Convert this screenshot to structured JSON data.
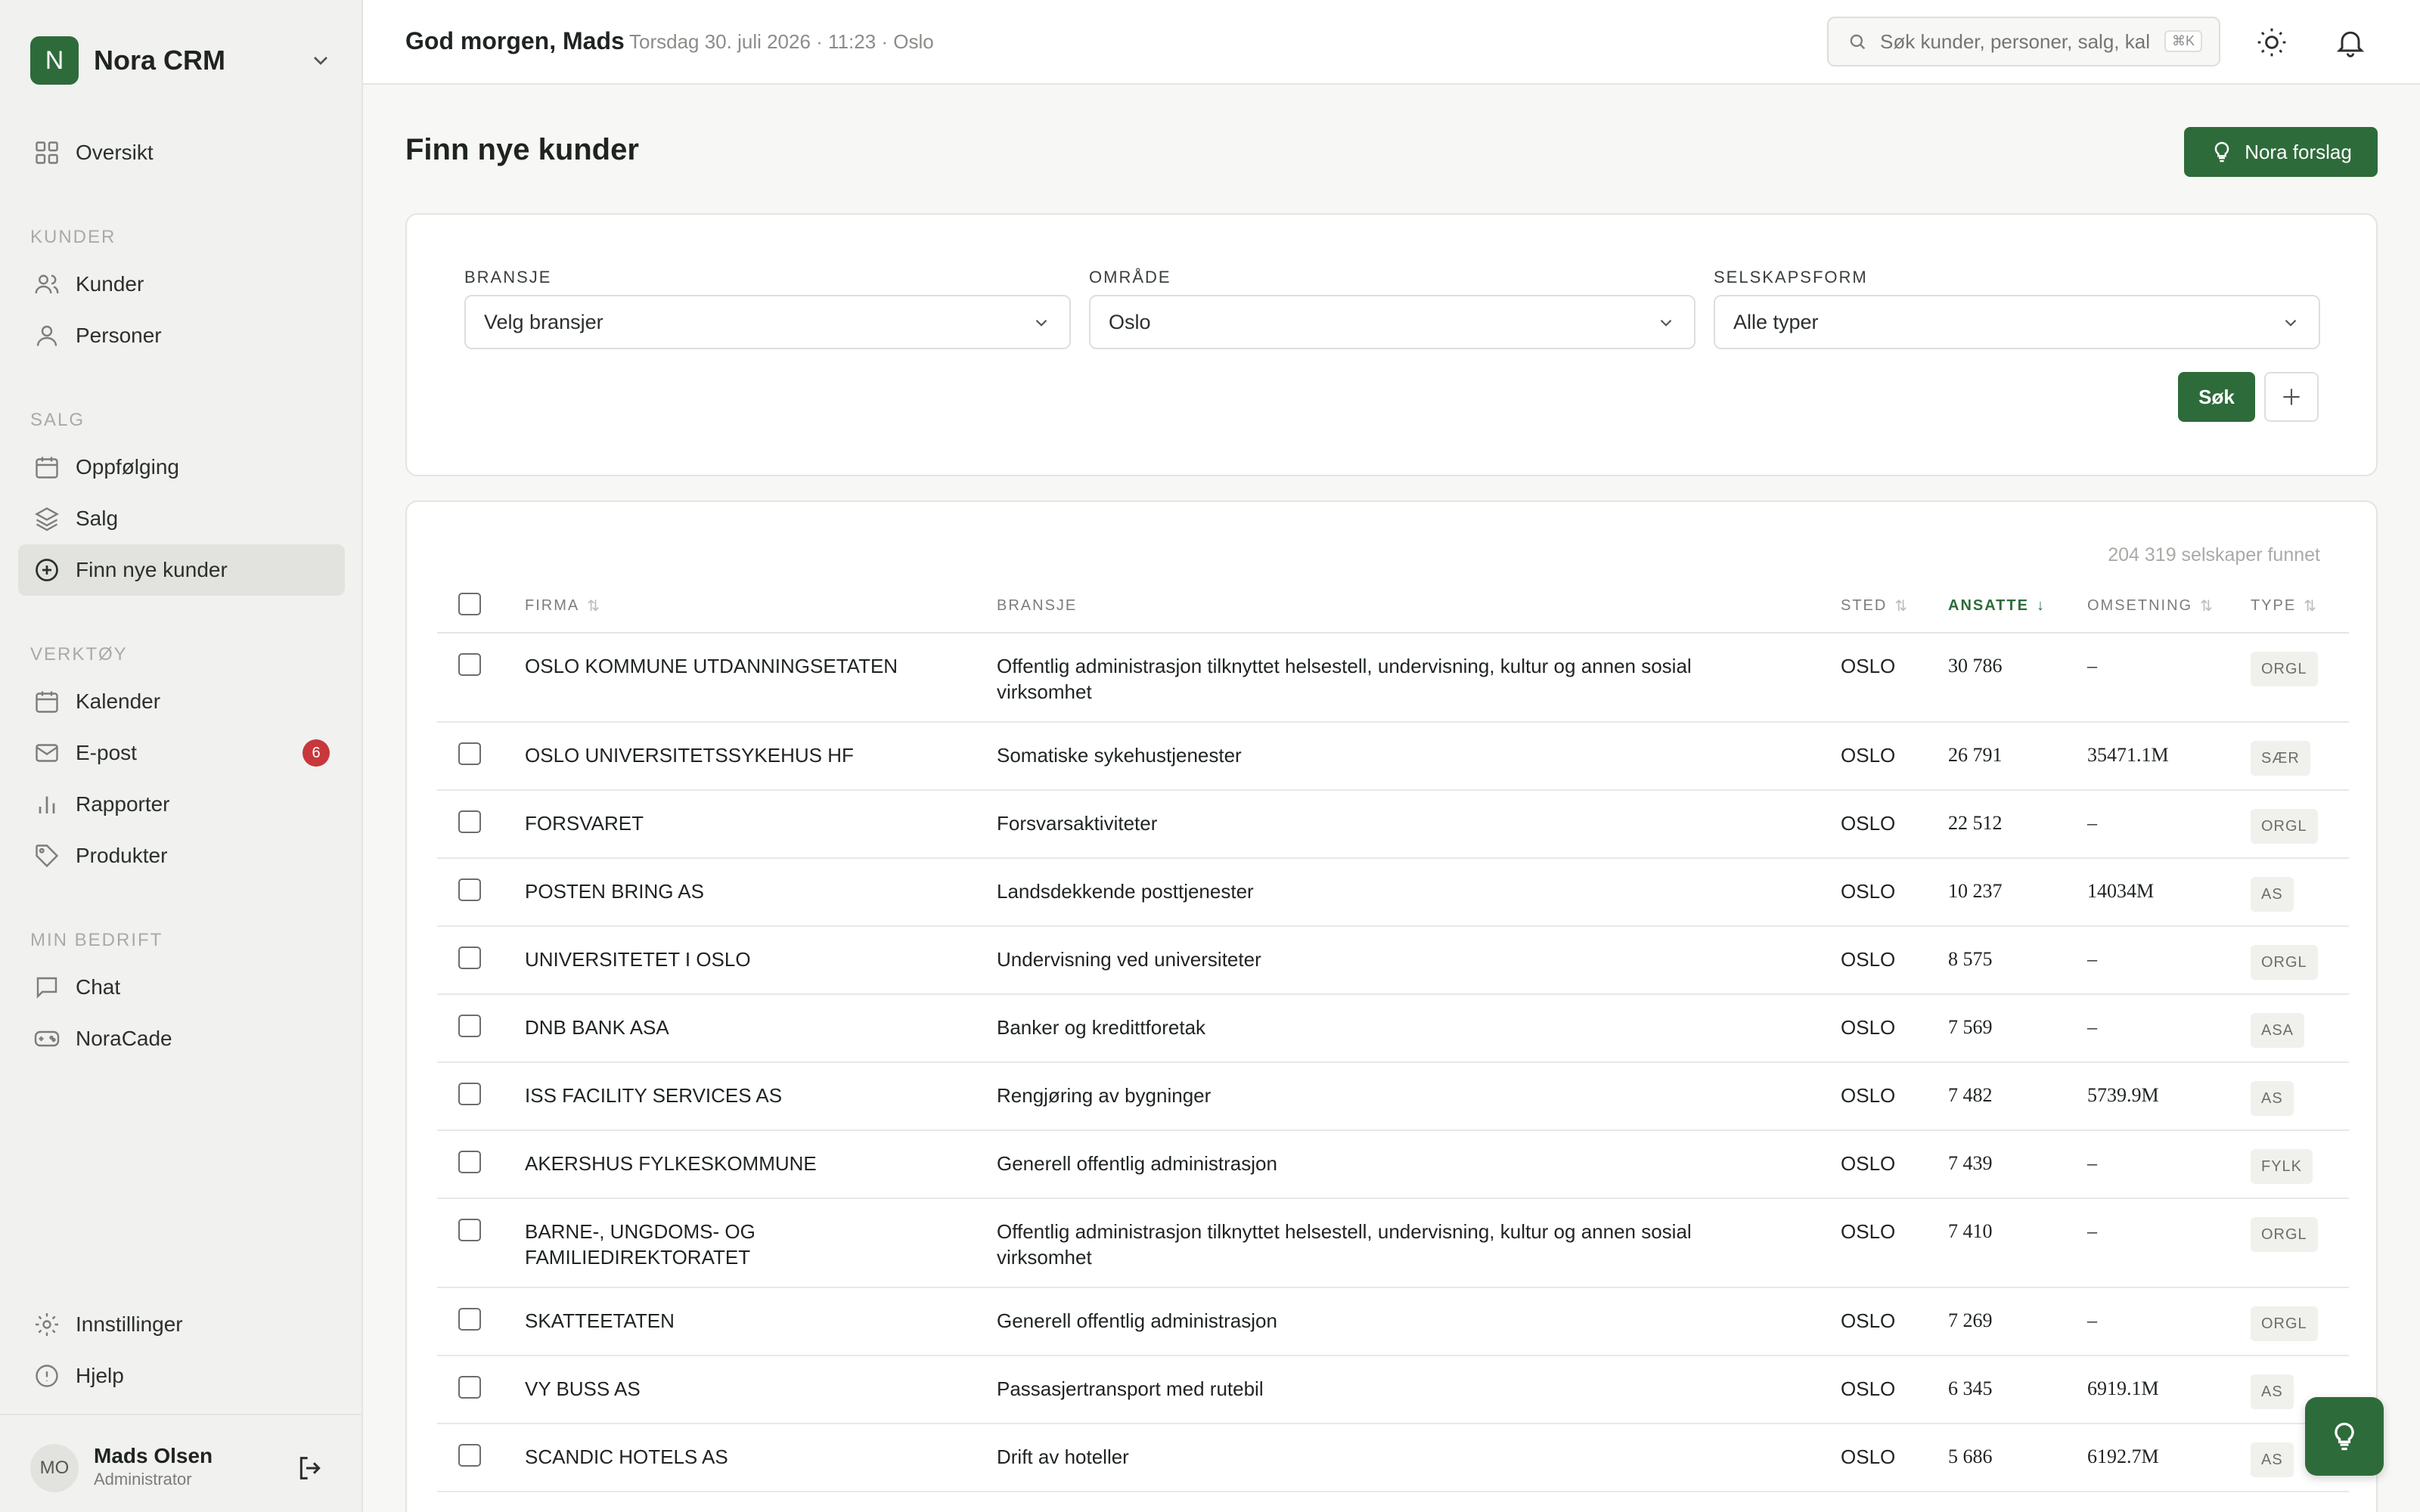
{
  "brand": {
    "logo_letter": "N",
    "name": "Nora CRM"
  },
  "sidebar": {
    "overview": "Oversikt",
    "sections": {
      "kunder": "KUNDER",
      "salg": "SALG",
      "verktoy": "VERKTØY",
      "min_bedrift": "MIN BEDRIFT"
    },
    "items": {
      "kunder": "Kunder",
      "personer": "Personer",
      "oppfolging": "Oppfølging",
      "salg": "Salg",
      "finn_nye_kunder": "Finn nye kunder",
      "kalender": "Kalender",
      "epost": "E-post",
      "epost_badge": "6",
      "rapporter": "Rapporter",
      "produkter": "Produkter",
      "chat": "Chat",
      "noracade": "NoraCade",
      "innstillinger": "Innstillinger",
      "hjelp": "Hjelp"
    },
    "user": {
      "initials": "MO",
      "name": "Mads Olsen",
      "role": "Administrator"
    }
  },
  "topbar": {
    "greeting": "God morgen, Mads",
    "dateline": "Torsdag 30. juli 2026 · 11:23 · Oslo",
    "search_placeholder": "Søk kunder, personer, salg, kal",
    "search_shortcut": "⌘K"
  },
  "page": {
    "title": "Finn nye kunder",
    "nora_button": "Nora forslag"
  },
  "filters": {
    "bransje": {
      "label": "BRANSJE",
      "value": "Velg bransjer"
    },
    "omrade": {
      "label": "OMRÅDE",
      "value": "Oslo"
    },
    "selskapsform": {
      "label": "SELSKAPSFORM",
      "value": "Alle typer"
    },
    "search_button": "Søk"
  },
  "table": {
    "result_count": "204 319 selskaper funnet",
    "headers": {
      "firma": "FIRMA",
      "bransje": "BRANSJE",
      "sted": "STED",
      "ansatte": "ANSATTE",
      "omsetning": "OMSETNING",
      "type": "TYPE"
    },
    "rows": [
      {
        "firma": "OSLO KOMMUNE UTDANNINGSETATEN",
        "bransje": "Offentlig administrasjon tilknyttet helsestell, undervisning, kultur og annen sosial virksomhet",
        "sted": "OSLO",
        "ansatte": "30 786",
        "omsetning": "–",
        "type": "ORGL"
      },
      {
        "firma": "OSLO UNIVERSITETSSYKEHUS HF",
        "bransje": "Somatiske sykehustjenester",
        "sted": "OSLO",
        "ansatte": "26 791",
        "omsetning": "35471.1M",
        "type": "SÆR"
      },
      {
        "firma": "FORSVARET",
        "bransje": "Forsvarsaktiviteter",
        "sted": "OSLO",
        "ansatte": "22 512",
        "omsetning": "–",
        "type": "ORGL"
      },
      {
        "firma": "POSTEN BRING AS",
        "bransje": "Landsdekkende posttjenester",
        "sted": "OSLO",
        "ansatte": "10 237",
        "omsetning": "14034M",
        "type": "AS"
      },
      {
        "firma": "UNIVERSITETET I OSLO",
        "bransje": "Undervisning ved universiteter",
        "sted": "OSLO",
        "ansatte": "8 575",
        "omsetning": "–",
        "type": "ORGL"
      },
      {
        "firma": "DNB BANK ASA",
        "bransje": "Banker og kredittforetak",
        "sted": "OSLO",
        "ansatte": "7 569",
        "omsetning": "–",
        "type": "ASA"
      },
      {
        "firma": "ISS FACILITY SERVICES AS",
        "bransje": "Rengjøring av bygninger",
        "sted": "OSLO",
        "ansatte": "7 482",
        "omsetning": "5739.9M",
        "type": "AS"
      },
      {
        "firma": "AKERSHUS FYLKESKOMMUNE",
        "bransje": "Generell offentlig administrasjon",
        "sted": "OSLO",
        "ansatte": "7 439",
        "omsetning": "–",
        "type": "FYLK"
      },
      {
        "firma": "BARNE-, UNGDOMS- OG FAMILIEDIREKTORATET",
        "bransje": "Offentlig administrasjon tilknyttet helsestell, undervisning, kultur og annen sosial virksomhet",
        "sted": "OSLO",
        "ansatte": "7 410",
        "omsetning": "–",
        "type": "ORGL"
      },
      {
        "firma": "SKATTEETATEN",
        "bransje": "Generell offentlig administrasjon",
        "sted": "OSLO",
        "ansatte": "7 269",
        "omsetning": "–",
        "type": "ORGL"
      },
      {
        "firma": "VY BUSS AS",
        "bransje": "Passasjertransport med rutebil",
        "sted": "OSLO",
        "ansatte": "6 345",
        "omsetning": "6919.1M",
        "type": "AS"
      },
      {
        "firma": "SCANDIC HOTELS AS",
        "bransje": "Drift av hoteller",
        "sted": "OSLO",
        "ansatte": "5 686",
        "omsetning": "6192.7M",
        "type": "AS"
      }
    ]
  },
  "colors": {
    "accent": "#2e6b3a",
    "badge": "#c8373b"
  }
}
